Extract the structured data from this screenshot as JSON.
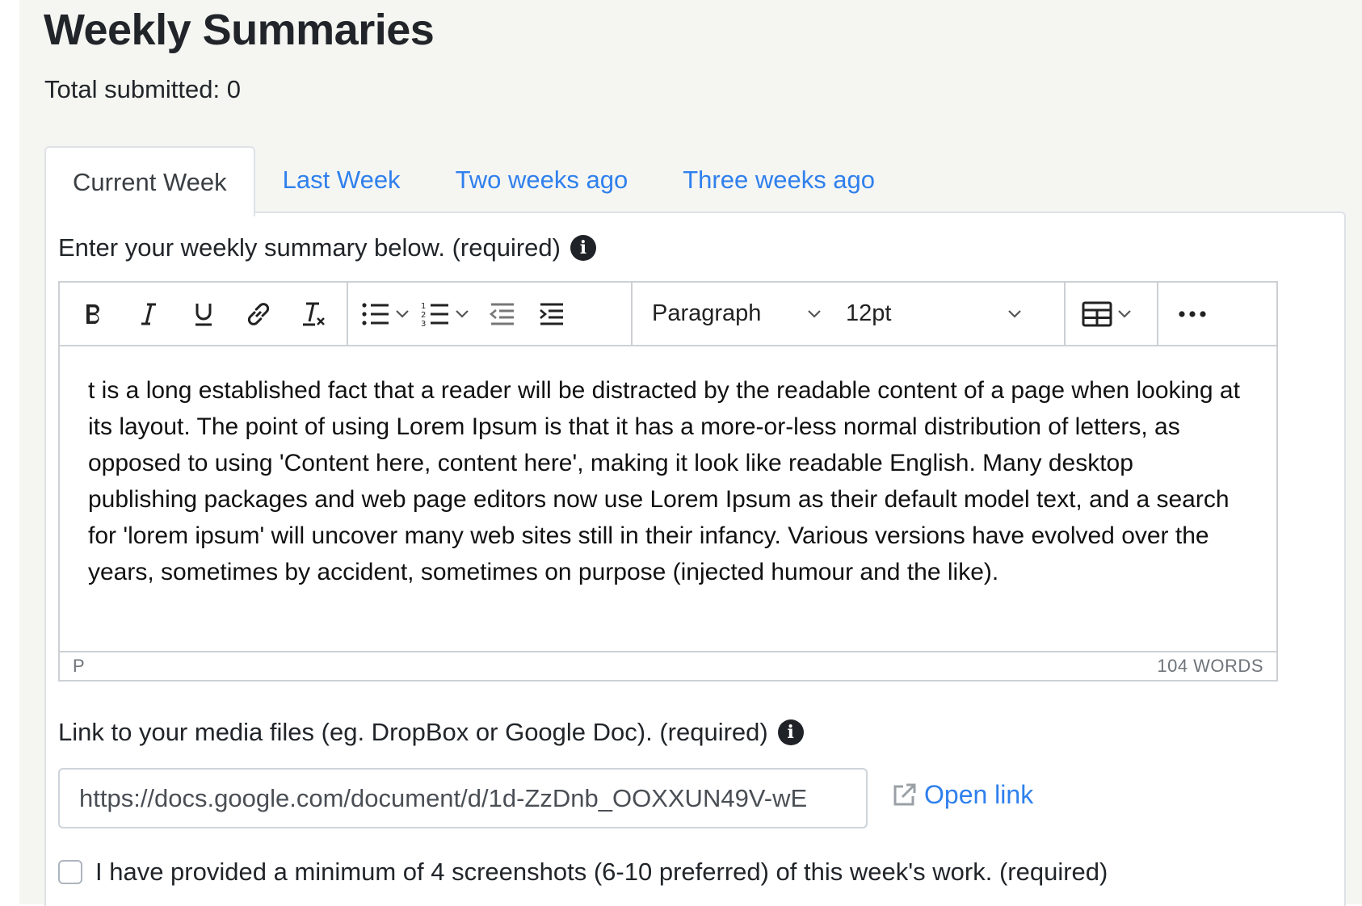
{
  "page": {
    "title": "Weekly Summaries",
    "total_label": "Total submitted: 0"
  },
  "tabs": [
    {
      "label": "Current Week",
      "active": true
    },
    {
      "label": "Last Week",
      "active": false
    },
    {
      "label": "Two weeks ago",
      "active": false
    },
    {
      "label": "Three weeks ago",
      "active": false
    }
  ],
  "summary_field": {
    "label": "Enter your weekly summary below. (required)",
    "info_icon": "info-icon"
  },
  "editor": {
    "toolbar": {
      "bold_icon": "bold-icon",
      "italic_icon": "italic-icon",
      "underline_icon": "underline-icon",
      "link_icon": "link-icon",
      "clear_format_icon": "clear-formatting-icon",
      "bullet_list_icon": "bullet-list-icon",
      "numbered_list_icon": "numbered-list-icon",
      "outdent_icon": "outdent-icon",
      "indent_icon": "indent-icon",
      "block_format": "Paragraph",
      "font_size": "12pt",
      "table_icon": "table-icon",
      "more_icon": "more-icon"
    },
    "content": "t is a long established fact that a reader will be distracted by the readable content of a page when looking at its layout. The point of using Lorem Ipsum is that it has a more-or-less normal distribution of letters, as opposed to using 'Content here, content here', making it look like readable English. Many desktop publishing packages and web page editors now use Lorem Ipsum as their default model text, and a search for 'lorem ipsum' will uncover many web sites still in their infancy. Various versions have evolved over the years, sometimes by accident, sometimes on purpose (injected humour and the like).",
    "status_path": "P",
    "word_count": "104 WORDS"
  },
  "media_field": {
    "label": "Link to your media files (eg. DropBox or Google Doc). (required)",
    "info_icon": "info-icon",
    "value": "https://docs.google.com/document/d/1d-ZzDnb_OOXXUN49V-wE",
    "open_link_label": "Open link",
    "open_link_icon": "external-link-icon"
  },
  "screenshots_check": {
    "label": "I have provided a minimum of 4 screenshots (6-10 preferred) of this week's work. (required)",
    "checked": false
  },
  "colors": {
    "link": "#2f80ed",
    "panel_background": "#f5f5f2",
    "border": "#dee2e6"
  }
}
